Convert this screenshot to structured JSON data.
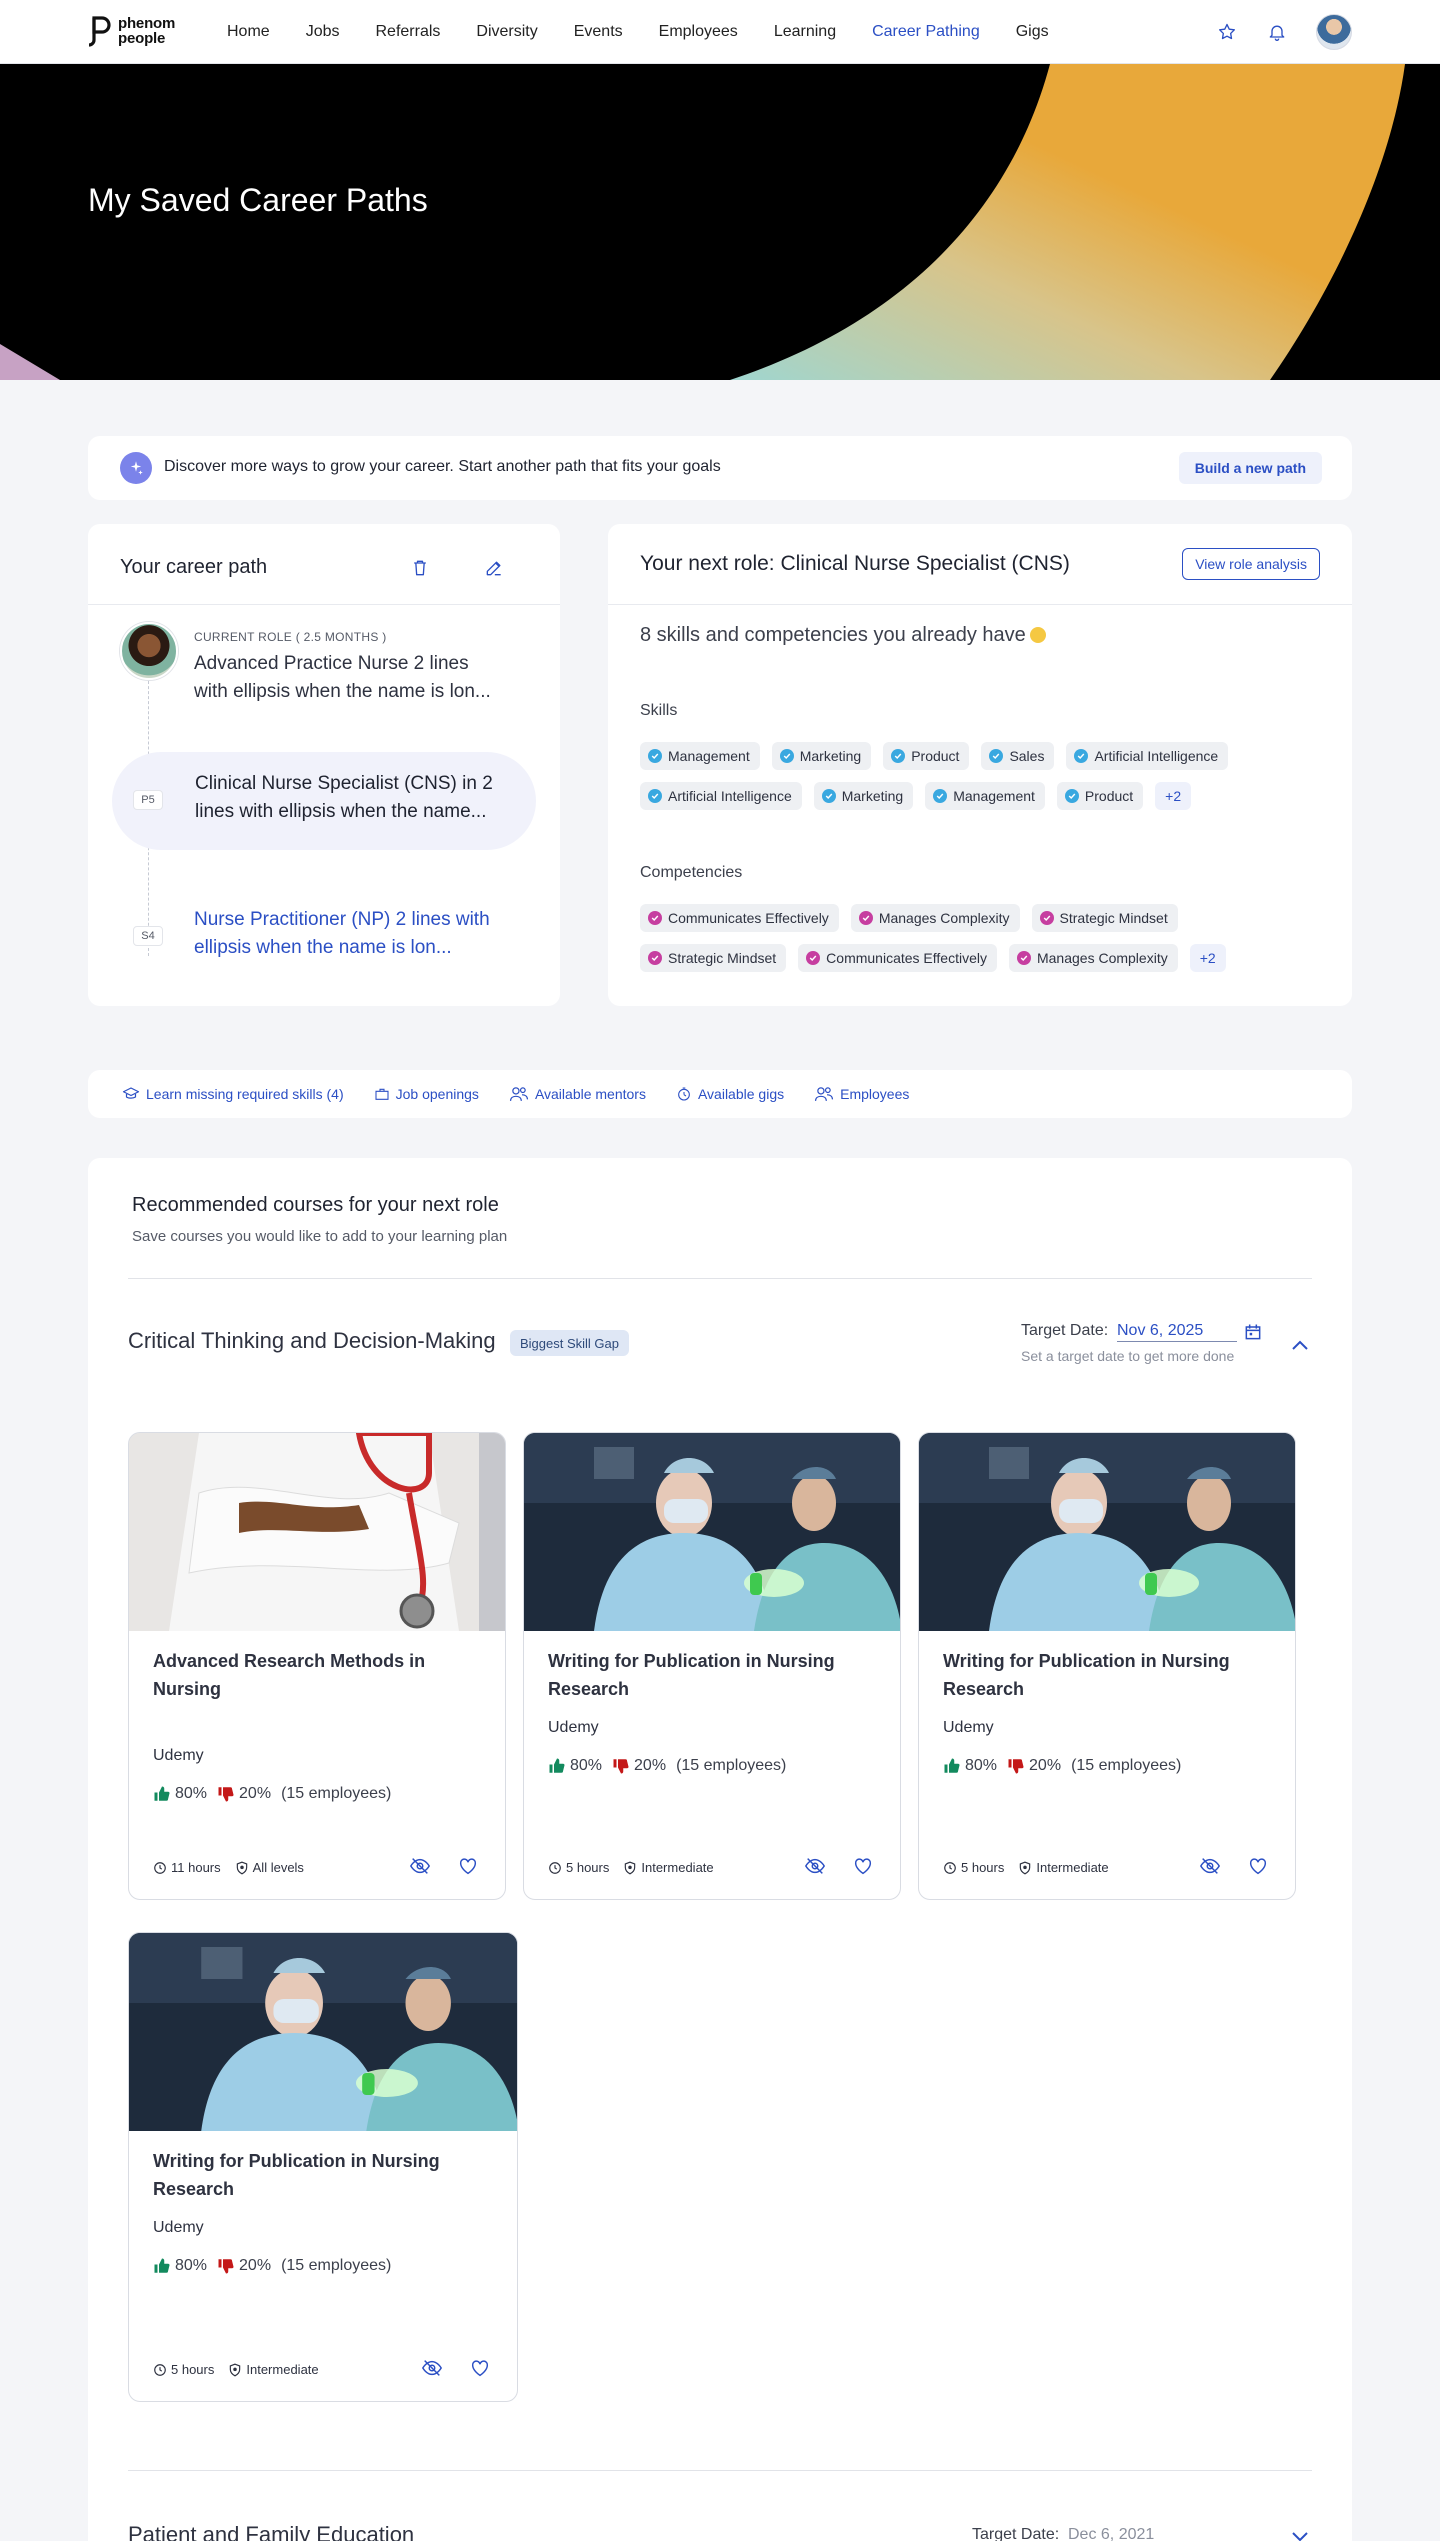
{
  "brand": {
    "name_line1": "phenom",
    "name_line2": "people"
  },
  "nav": {
    "items": [
      "Home",
      "Jobs",
      "Referrals",
      "Diversity",
      "Events",
      "Employees",
      "Learning",
      "Career Pathing",
      "Gigs"
    ],
    "active": "Career Pathing",
    "icons": [
      "star-icon",
      "bell-icon",
      "user-avatar"
    ]
  },
  "hero": {
    "title": "My Saved Career Paths"
  },
  "banner": {
    "text": "Discover more ways to grow your career. Start another path that fits your goals",
    "button": "Build a new path"
  },
  "career_path": {
    "title": "Your career path",
    "current_label": "CURRENT ROLE ( 2.5 MONTHS )",
    "current_role": "Advanced Practice Nurse 2 lines with ellipsis when the name is lon...",
    "selected_step": "P5",
    "selected_role": "Clinical Nurse Specialist (CNS) in 2 lines with ellipsis when the name...",
    "next_step": "S4",
    "next_role": "Nurse Practitioner (NP) 2 lines with ellipsis when the name is lon..."
  },
  "next_role": {
    "title": "Your next role: Clinical Nurse Specialist (CNS)",
    "button": "View role analysis",
    "count_text": "8 skills and competencies you already have",
    "skills_label": "Skills",
    "skills_row1": [
      "Management",
      "Marketing",
      "Product",
      "Sales",
      "Artificial Intelligence"
    ],
    "skills_row2": [
      "Artificial Intelligence",
      "Marketing",
      "Management",
      "Product"
    ],
    "skills_more": "+2",
    "competencies_label": "Competencies",
    "comp_row1": [
      "Communicates Effectively",
      "Manages Complexity",
      "Strategic Mindset"
    ],
    "comp_row2": [
      "Strategic Mindset",
      "Communicates Effectively",
      "Manages Complexity"
    ],
    "comp_more": "+2"
  },
  "links": [
    {
      "icon": "graduation-cap-icon",
      "label": "Learn missing required skills (4)"
    },
    {
      "icon": "briefcase-icon",
      "label": "Job openings"
    },
    {
      "icon": "mentors-icon",
      "label": "Available mentors"
    },
    {
      "icon": "stopwatch-icon",
      "label": "Available gigs"
    },
    {
      "icon": "people-icon",
      "label": "Employees"
    }
  ],
  "recommended": {
    "title": "Recommended courses for your next role",
    "subtitle": "Save courses you would like to add to your learning plan",
    "skill1": {
      "name": "Critical Thinking and Decision-Making",
      "badge": "Biggest Skill Gap",
      "target_label": "Target Date:",
      "target_value": "Nov 6, 2025",
      "hint": "Set a target date to get more done"
    },
    "skill2": {
      "name": "Patient and Family Education",
      "target_label": "Target Date:",
      "target_value": "Dec 6, 2021"
    }
  },
  "courses": [
    {
      "title": "Advanced Research Methods in Nursing",
      "provider": "Udemy",
      "up": "80%",
      "down": "20%",
      "employees": "(15 employees)",
      "hours": "11 hours",
      "level": "All levels",
      "image": "doctor-stethoscope"
    },
    {
      "title": "Writing for Publication in Nursing Research",
      "provider": "Udemy",
      "up": "80%",
      "down": "20%",
      "employees": "(15 employees)",
      "hours": "5 hours",
      "level": "Intermediate",
      "image": "surgeons"
    },
    {
      "title": "Writing for Publication in Nursing Research",
      "provider": "Udemy",
      "up": "80%",
      "down": "20%",
      "employees": "(15 employees)",
      "hours": "5 hours",
      "level": "Intermediate",
      "image": "surgeons"
    },
    {
      "title": "Writing for Publication in Nursing Research",
      "provider": "Udemy",
      "up": "80%",
      "down": "20%",
      "employees": "(15 employees)",
      "hours": "5 hours",
      "level": "Intermediate",
      "image": "surgeons"
    }
  ],
  "colors": {
    "accent": "#2b4fc4",
    "thumb_up": "#138a5e",
    "thumb_down": "#c41818",
    "hero_gold": "#e8a83a"
  }
}
